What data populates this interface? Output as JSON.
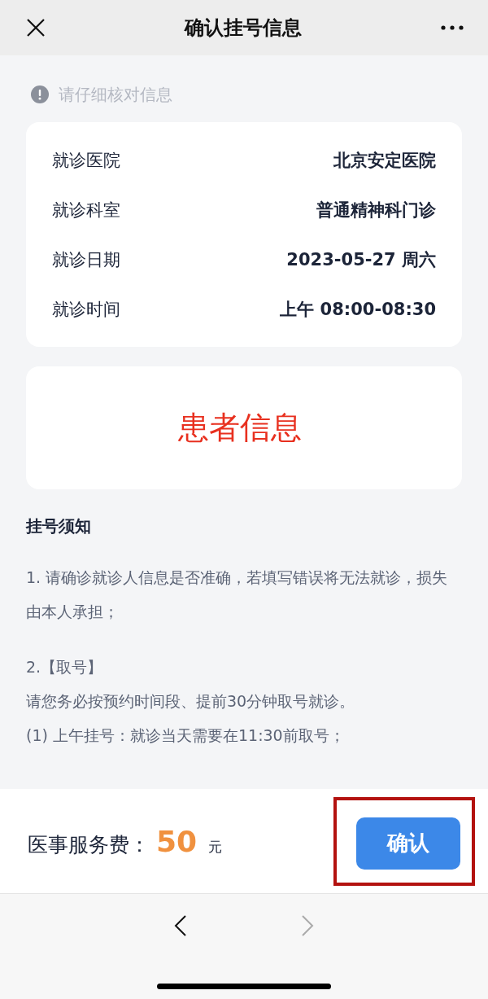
{
  "header": {
    "title": "确认挂号信息"
  },
  "hint": "请仔细核对信息",
  "details": [
    {
      "label": "就诊医院",
      "value": "北京安定医院"
    },
    {
      "label": "就诊科室",
      "value": "普通精神科门诊"
    },
    {
      "label": "就诊日期",
      "value": "2023-05-27 周六"
    },
    {
      "label": "就诊时间",
      "value": "上午 08:00-08:30"
    }
  ],
  "patient_card": {
    "text": "患者信息"
  },
  "notice": {
    "title": "挂号须知",
    "paragraphs": [
      [
        "1. 请确诊就诊人信息是否准确，若填写错误将无法就诊，损失由本人承担；"
      ],
      [
        "2.【取号】",
        "请您务必按预约时间段、提前30分钟取号就诊。",
        "(1) 上午挂号：就诊当天需要在11:30前取号；"
      ]
    ]
  },
  "footer": {
    "fee_label": "医事服务费：",
    "amount": "50",
    "unit": "元",
    "button": "确认",
    "button_highlighted": true
  },
  "nav": [
    {
      "kind": "back",
      "disabled": false
    },
    {
      "kind": "forward",
      "disabled": true
    }
  ]
}
